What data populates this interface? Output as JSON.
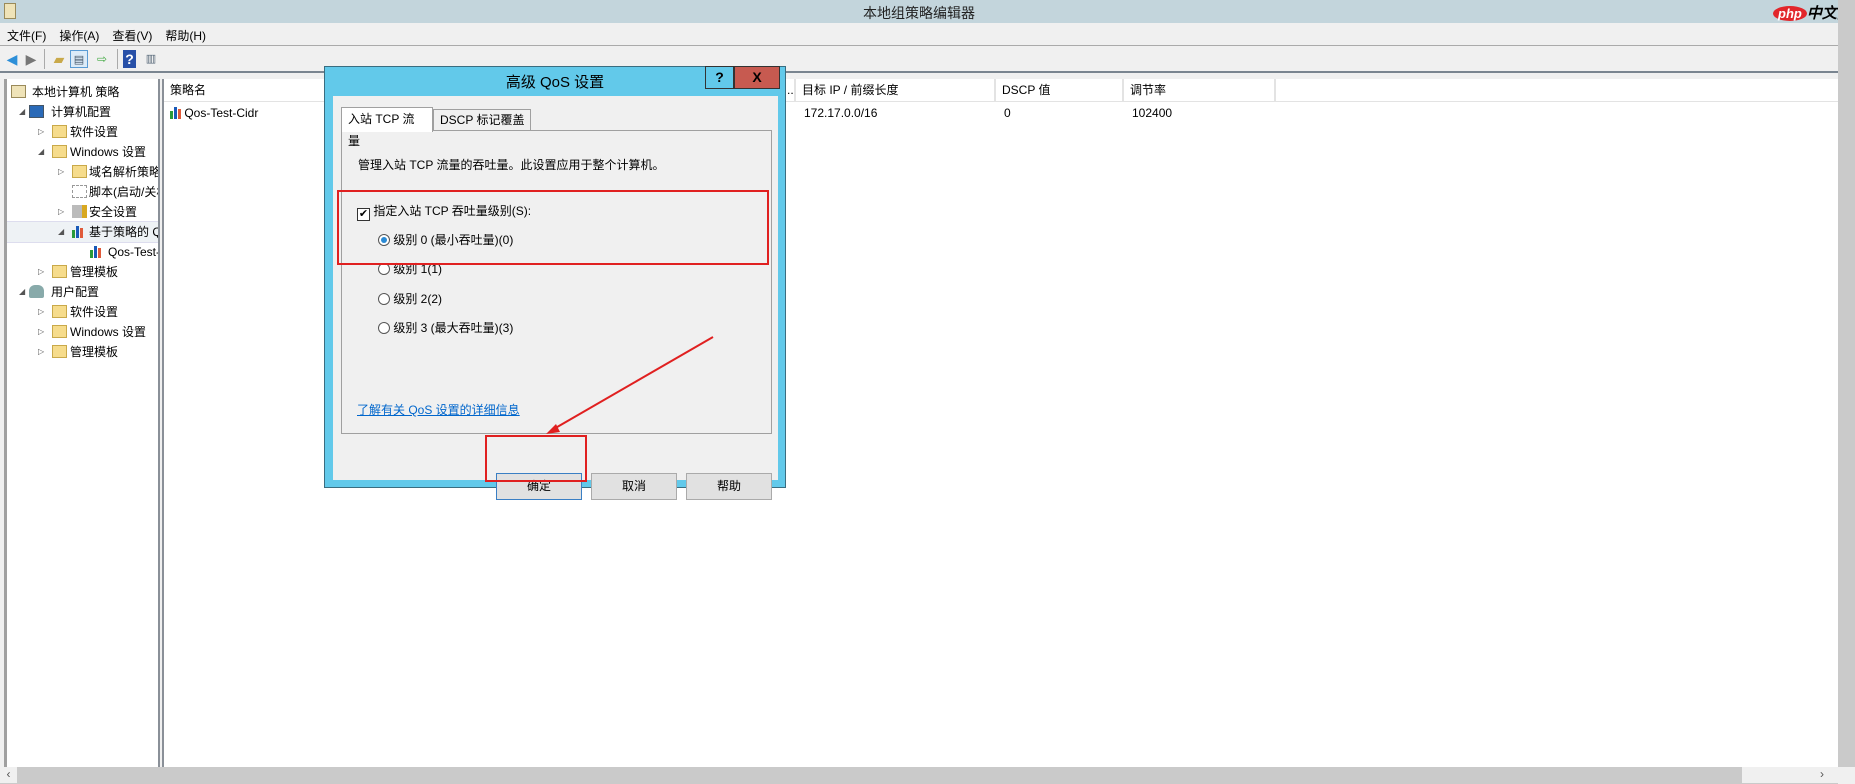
{
  "window": {
    "title": "本地组策略编辑器",
    "watermark": "php中文网"
  },
  "menu": [
    "文件(F)",
    "操作(A)",
    "查看(V)",
    "帮助(H)"
  ],
  "toolbar": {
    "icons": [
      "back-icon",
      "forward-icon",
      "up-folder-icon",
      "show-hide-tree-icon",
      "export-list-icon",
      "help-icon",
      "show-action-pane-icon"
    ]
  },
  "tree": [
    {
      "label": "本地计算机 策略",
      "level": 0,
      "icon": "policy-scroll-icon",
      "toggle": ""
    },
    {
      "label": "计算机配置",
      "level": 1,
      "icon": "computer-icon",
      "toggle": "expanded"
    },
    {
      "label": "软件设置",
      "level": 2,
      "icon": "folder-icon",
      "toggle": "collapsed"
    },
    {
      "label": "Windows 设置",
      "level": 2,
      "icon": "folder-icon",
      "toggle": "expanded"
    },
    {
      "label": "域名解析策略",
      "level": 3,
      "icon": "folder-icon",
      "toggle": "collapsed"
    },
    {
      "label": "脚本(启动/关机)",
      "level": 3,
      "icon": "script-icon",
      "toggle": ""
    },
    {
      "label": "安全设置",
      "level": 3,
      "icon": "security-icon",
      "toggle": "collapsed"
    },
    {
      "label": "基于策略的 QoS",
      "level": 3,
      "icon": "qos-chart-icon",
      "toggle": "expanded"
    },
    {
      "label": "Qos-Test-Cidr",
      "level": 4,
      "icon": "qos-chart-icon",
      "toggle": ""
    },
    {
      "label": "管理模板",
      "level": 2,
      "icon": "folder-icon",
      "toggle": "collapsed"
    },
    {
      "label": "用户配置",
      "level": 1,
      "icon": "user-icon",
      "toggle": "expanded"
    },
    {
      "label": "软件设置",
      "level": 2,
      "icon": "folder-icon",
      "toggle": "collapsed"
    },
    {
      "label": "Windows 设置",
      "level": 2,
      "icon": "folder-icon",
      "toggle": "collapsed"
    },
    {
      "label": "管理模板",
      "level": 2,
      "icon": "folder-icon",
      "toggle": "collapsed"
    }
  ],
  "list": {
    "columns": [
      "策略名",
      "目标 IP / 前缀长度",
      "DSCP 值",
      "调节率"
    ],
    "rows": [
      {
        "name": "Qos-Test-Cidr",
        "ip": "172.17.0.0/16",
        "dscp": "0",
        "rate": "102400"
      }
    ]
  },
  "dialog": {
    "title": "高级 QoS 设置",
    "help_btn": "?",
    "close_btn": "X",
    "tabs": [
      "入站 TCP 流量",
      "DSCP 标记覆盖"
    ],
    "description": "管理入站 TCP 流量的吞吐量。此设置应用于整个计算机。",
    "checkbox_label": "指定入站 TCP 吞吐量级别(S):",
    "checkbox_checked": true,
    "options": [
      "级别 0 (最小吞吐量)(0)",
      "级别 1(1)",
      "级别 2(2)",
      "级别 3 (最大吞吐量)(3)"
    ],
    "selected_option": 0,
    "link": "了解有关 QoS 设置的详细信息",
    "ok": "确定",
    "cancel": "取消",
    "help": "帮助"
  },
  "colors": {
    "dialog_frame": "#62c9ea",
    "close": "#c75a50",
    "annotation": "#e02020",
    "link": "#0066cc"
  }
}
